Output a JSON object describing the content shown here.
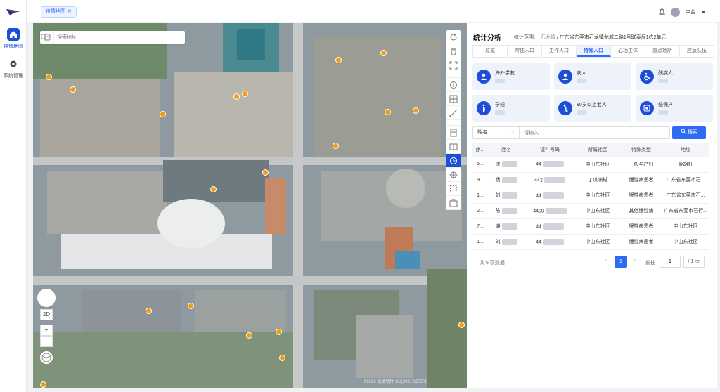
{
  "nav": {
    "items": [
      {
        "label": "疫情地图",
        "icon": "home-icon",
        "active": true
      },
      {
        "label": "系统管理",
        "icon": "gear-icon",
        "active": false
      }
    ]
  },
  "topbar": {
    "tab_label": "疫情地图",
    "tab_close": "✕",
    "user_name": "中台"
  },
  "map": {
    "search_placeholder": "搜索地址",
    "zoom_2d": "2D",
    "zoom_in": "+",
    "zoom_out": "−",
    "attribution": "©2023 高德软件 GS(2021)6375号"
  },
  "panel": {
    "title": "统计分析",
    "scope_label": "统计范围:",
    "scope_hl": "石龙镇",
    "scope_sep": " / ",
    "scope_value": "广东省东莞市石龙镇龙城二路1号联泰局1栋2单元",
    "tabs": [
      "总览",
      "常住人口",
      "工作人口",
      "特殊人口",
      "心场主体",
      "重点场所",
      "应急队伍"
    ],
    "active_tab": 3,
    "cards": [
      {
        "label": "海外学友",
        "icon": "student-icon"
      },
      {
        "label": "病人",
        "icon": "patient-icon"
      },
      {
        "label": "残疾人",
        "icon": "wheelchair-icon"
      },
      {
        "label": "孕妇",
        "icon": "pregnant-icon"
      },
      {
        "label": "80岁以上老人",
        "icon": "elderly-icon"
      },
      {
        "label": "低保户",
        "icon": "welfare-icon"
      }
    ],
    "filter": {
      "select_value": "姓名",
      "input_placeholder": "请输入",
      "search_button": "搜索"
    },
    "table": {
      "headers": [
        "序...",
        "姓名",
        "证件号码",
        "所属社区",
        "特殊类型",
        "地址"
      ],
      "rows": [
        {
          "idx": "5...",
          "name": "沈",
          "id": "44",
          "community": "中山东社区",
          "type": "一般孕产妇",
          "address": "黄胡杆"
        },
        {
          "idx": "9...",
          "name": "杨",
          "id": "442",
          "community": "丁瓜洲村",
          "type": "慢性病患者",
          "address": "广东省东莞市石..."
        },
        {
          "idx": "1...",
          "name": "刘",
          "id": "44",
          "community": "中山东社区",
          "type": "慢性病患者",
          "address": "广东省东莞市石..."
        },
        {
          "idx": "2...",
          "name": "陈",
          "id": "4409",
          "community": "中山东社区",
          "type": "其他慢性病",
          "address": "广东省东莞市石行..."
        },
        {
          "idx": "7...",
          "name": "谢",
          "id": "44",
          "community": "中山东社区",
          "type": "慢性病患者",
          "address": "中山东社区"
        },
        {
          "idx": "1...",
          "name": "刘",
          "id": "44",
          "community": "中山东社区",
          "type": "慢性病患者",
          "address": "中山东社区"
        }
      ]
    },
    "pager": {
      "total": "共 6 项数据",
      "prev": "<",
      "page": "1",
      "next": ">",
      "goto": "前往",
      "goto_value": "1",
      "of": "/ 1 页"
    }
  },
  "colors": {
    "primary": "#2f6bf3",
    "nav_active": "#1d4ed8",
    "pin": "#f59e0b"
  }
}
